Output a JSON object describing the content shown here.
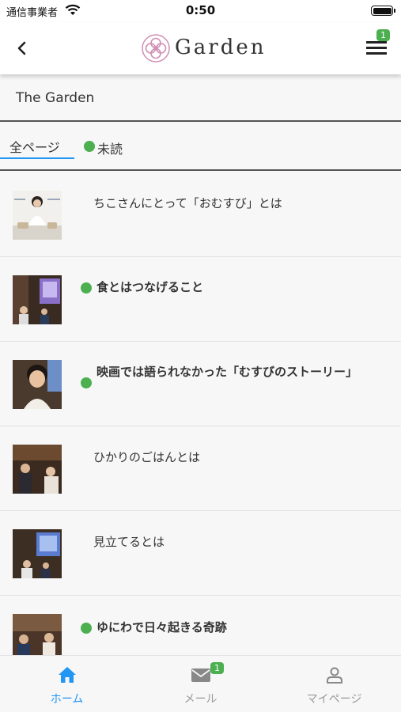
{
  "status_bar": {
    "carrier": "通信事業者",
    "time": "0:50"
  },
  "nav": {
    "brand": "Garden",
    "menu_badge": "1"
  },
  "section": {
    "title": "The Garden"
  },
  "tabs": {
    "all": "全ページ",
    "unread": "未読"
  },
  "items": [
    {
      "title": "ちこさんにとって「おむすび」とは",
      "unread": false,
      "thumbnail": "person-seated-photo"
    },
    {
      "title": "食とはつなげること",
      "unread": true,
      "thumbnail": "presentation-room-photo"
    },
    {
      "title": "映画では語られなかった「むすびのストーリー」",
      "unread": true,
      "thumbnail": "person-smiling-photo"
    },
    {
      "title": "ひかりのごはんとは",
      "unread": false,
      "thumbnail": "dim-room-photo"
    },
    {
      "title": "見立てるとは",
      "unread": false,
      "thumbnail": "screen-room-photo"
    },
    {
      "title": "ゆにわで日々起きる奇跡",
      "unread": true,
      "thumbnail": "group-photo"
    }
  ],
  "tab_bar": {
    "home": "ホーム",
    "mail": "メール",
    "mail_badge": "1",
    "mypage": "マイページ"
  },
  "colors": {
    "accent": "#2196f3",
    "unread": "#4caf50",
    "badge": "#4caf50"
  }
}
